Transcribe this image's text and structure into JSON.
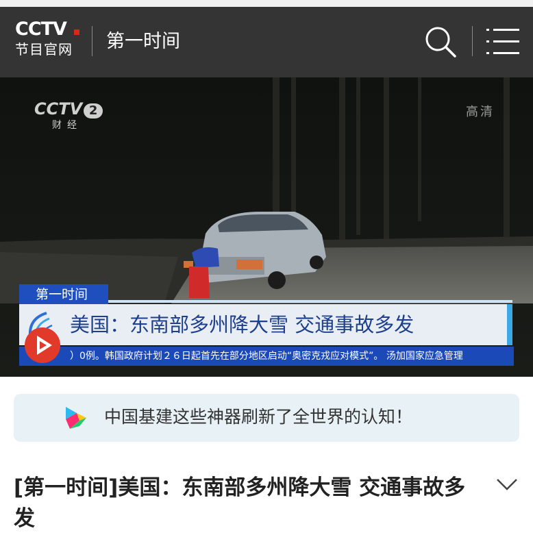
{
  "header": {
    "logo_main": "CCTV",
    "logo_sub": "节目官网",
    "title": "第一时间",
    "icons": [
      "search-icon",
      "menu-icon"
    ]
  },
  "video": {
    "channel_logo": "CCTV",
    "channel_number": "2",
    "channel_name": "财经",
    "hd_badge": "高清",
    "program_tag": "第一时间",
    "headline": "美国：东南部多州降大雪 交通事故多发",
    "ticker": "）0例。韩国政府计划２６日起首先在部分地区启动“奥密克戎应对模式”。   汤加国家应急管理"
  },
  "banner": {
    "icon": "app-logo-icon",
    "text": "中国基建这些神器刷新了全世界的认知！"
  },
  "article": {
    "title": "[第一时间]美国：东南部多州降大雪 交通事故多发",
    "expand_icon": "chevron-down-icon"
  },
  "colors": {
    "header_bg": "#343434",
    "tag_blue": "#1f4fbf",
    "headline_text": "#1d3f8c",
    "banner_bg": "#e8f1f6",
    "play_red": "#e23a2a"
  }
}
